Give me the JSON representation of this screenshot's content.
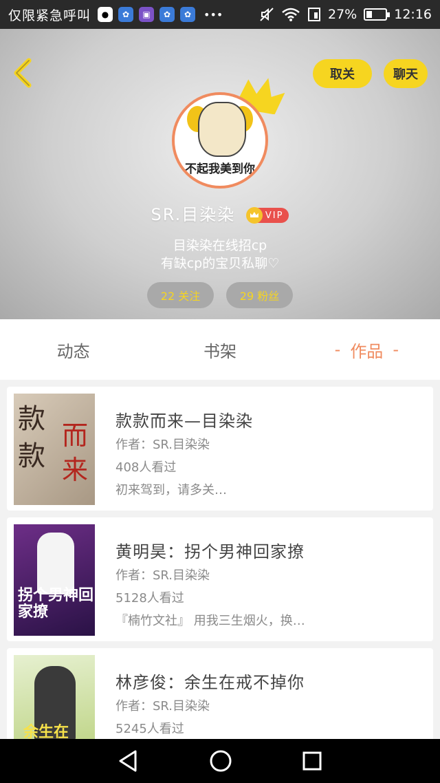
{
  "status_bar": {
    "carrier": "仅限紧急呼叫",
    "battery": "27%",
    "time": "12:16"
  },
  "header": {
    "unfollow_label": "取关",
    "chat_label": "聊天",
    "avatar_caption": "不起我美到你",
    "username": "SR.目染染",
    "vip_label": "VIP",
    "bio_line1": "目染染在线招cp",
    "bio_line2": "有缺cp的宝贝私聊♡",
    "following": "22 关注",
    "fans": "29 粉丝"
  },
  "tabs": {
    "dynamic": "动态",
    "bookshelf": "书架",
    "works": "作品",
    "dash": "-"
  },
  "books": [
    {
      "title": "款款而来—目染染",
      "author": "作者：SR.目染染",
      "views": "408人看过",
      "desc": "初来驾到，请多关…",
      "cover_text": [
        "款",
        "而",
        "款",
        "来"
      ]
    },
    {
      "title": "黄明昊：拐个男神回家撩",
      "author": "作者：SR.目染染",
      "views": "5128人看过",
      "desc": "『楠竹文社』 用我三生烟火，换…",
      "cover_text": "拐个男神回家撩"
    },
    {
      "title": "林彦俊：余生在戒不掉你",
      "author": "作者：SR.目染染",
      "views": "5245人看过",
      "cover_text": "余生在"
    }
  ],
  "colors": {
    "accent_yellow": "#f6d520",
    "accent_orange": "#f08b5f",
    "vip_red": "#e9514c"
  }
}
